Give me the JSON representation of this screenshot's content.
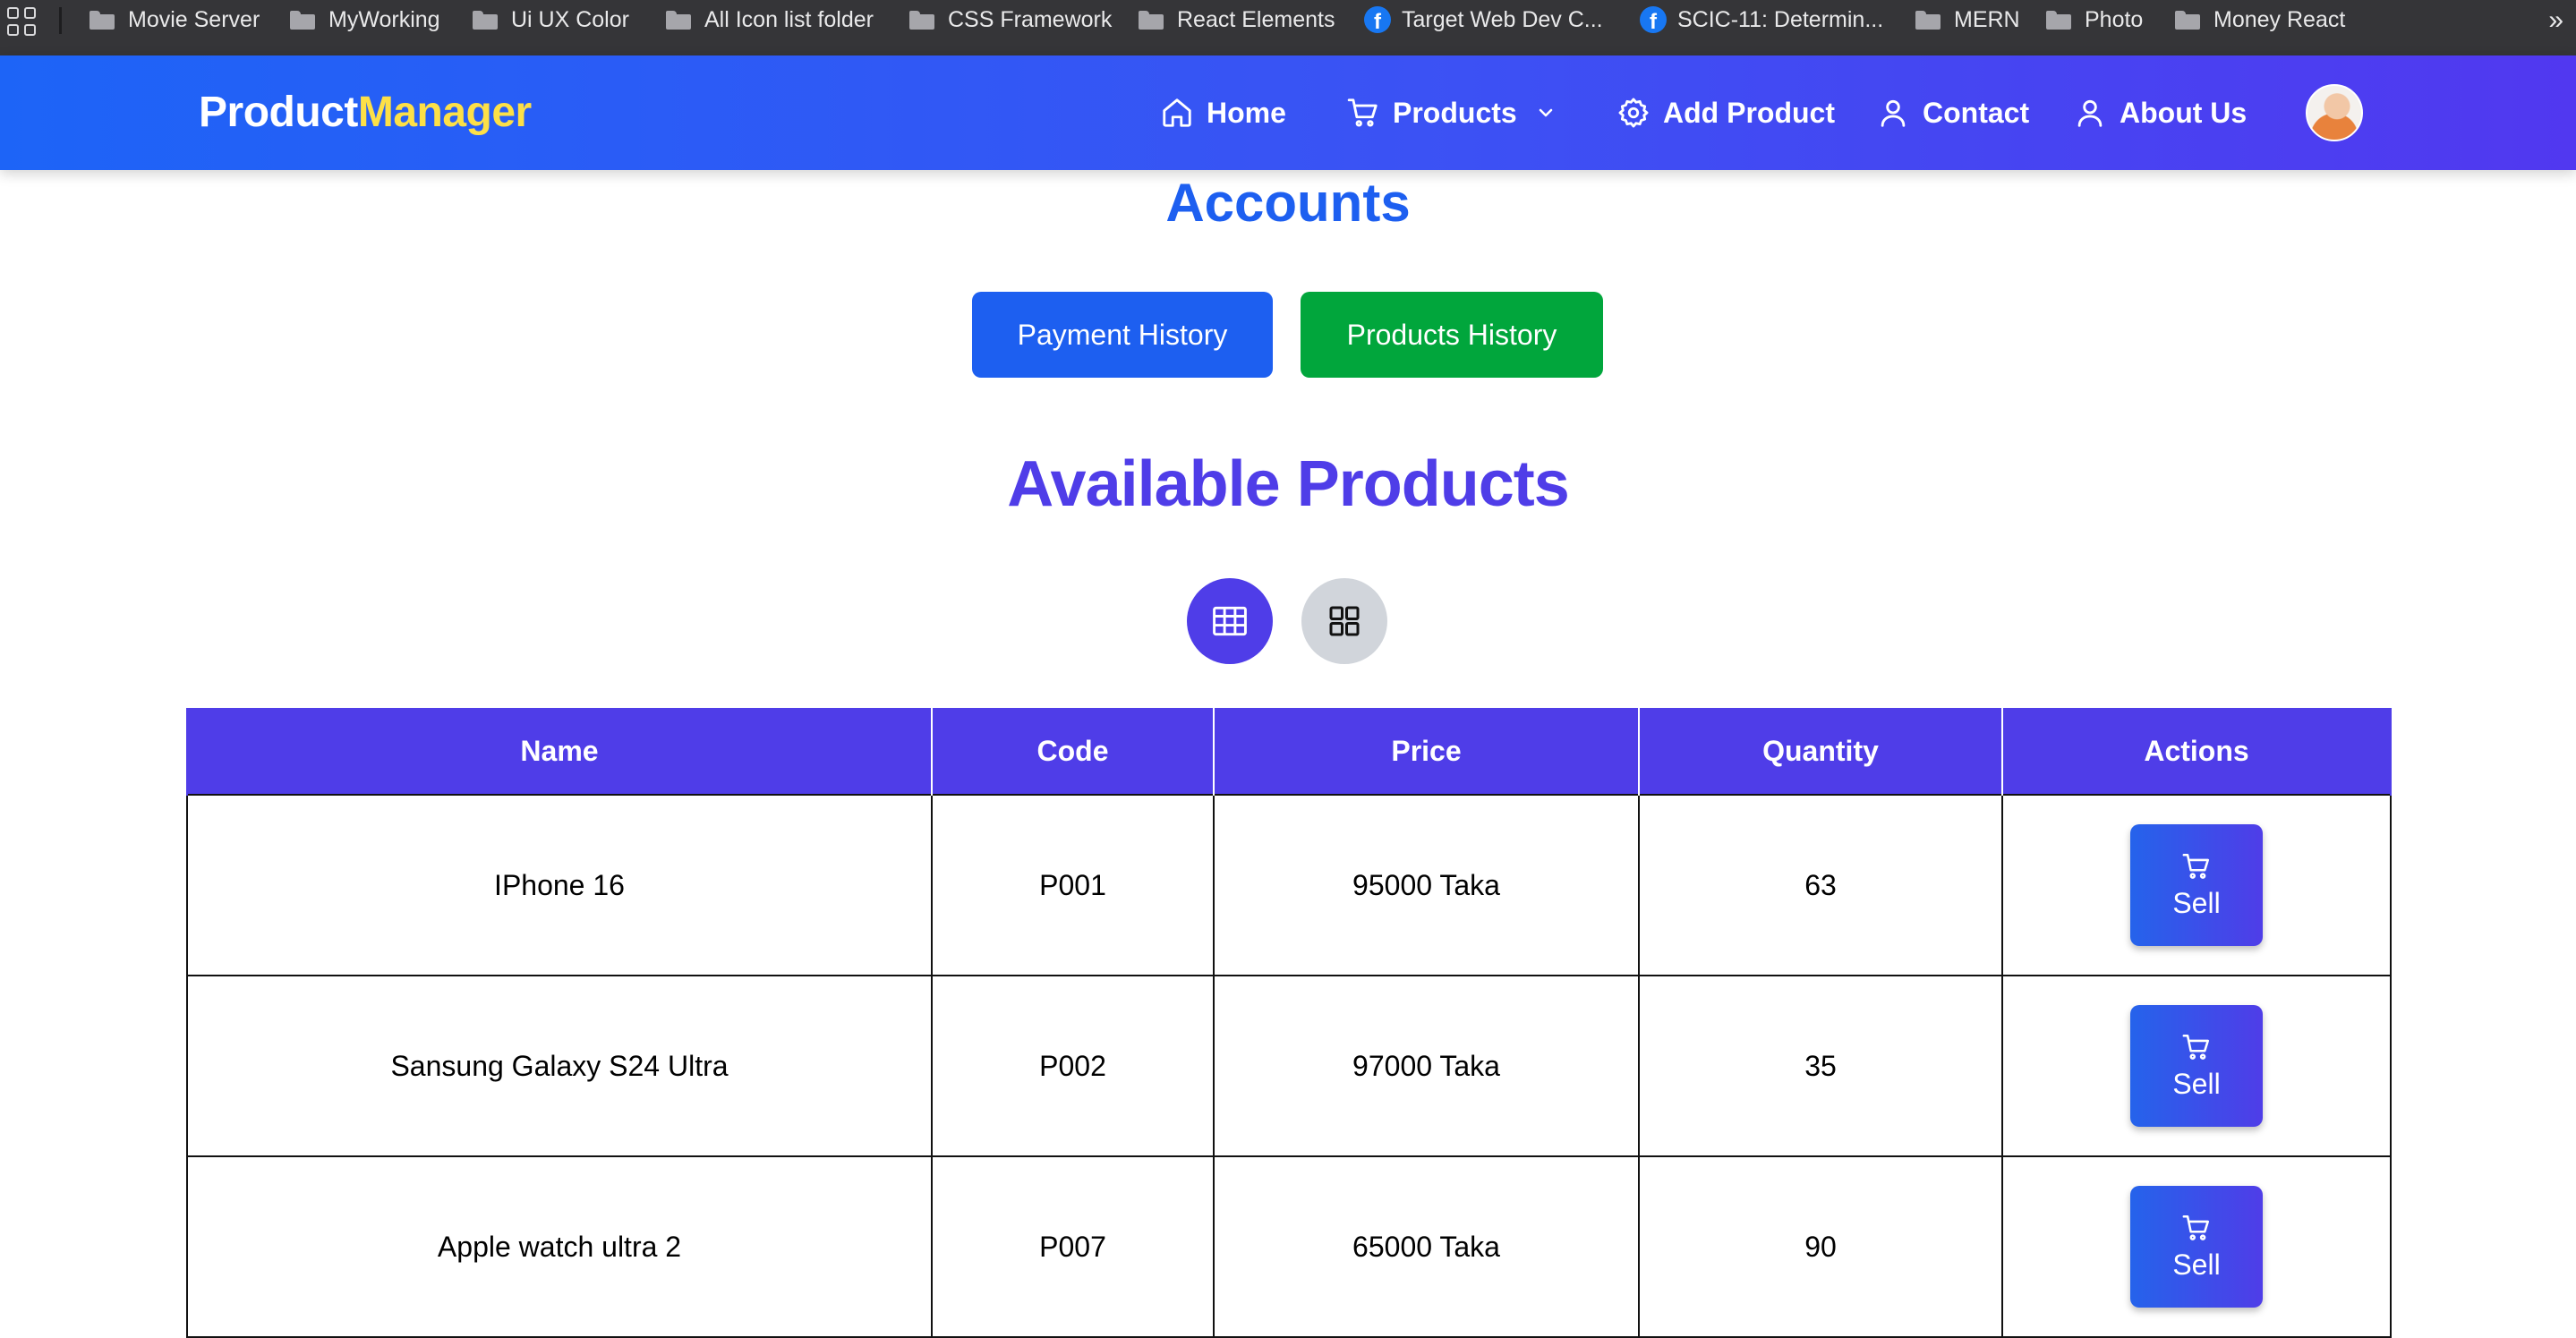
{
  "bookmarks": {
    "items": [
      {
        "label": "Movie Server",
        "icon": "folder-icon"
      },
      {
        "label": "MyWorking",
        "icon": "folder-icon"
      },
      {
        "label": "Ui UX Color",
        "icon": "folder-icon"
      },
      {
        "label": "All Icon list folder",
        "icon": "folder-icon"
      },
      {
        "label": "CSS Framework",
        "icon": "folder-icon"
      },
      {
        "label": "React Elements",
        "icon": "folder-icon"
      },
      {
        "label": "Target Web Dev C...",
        "icon": "facebook-icon"
      },
      {
        "label": "SCIC-11: Determin...",
        "icon": "facebook-icon"
      },
      {
        "label": "MERN",
        "icon": "folder-icon"
      },
      {
        "label": "Photo",
        "icon": "folder-icon"
      },
      {
        "label": "Money React",
        "icon": "folder-icon"
      }
    ],
    "more": "»"
  },
  "navbar": {
    "brand_part1": "Product",
    "brand_part2": "Manager",
    "links": {
      "home": "Home",
      "products": "Products",
      "add_product": "Add Product",
      "contact": "Contact",
      "about": "About Us"
    }
  },
  "accounts": {
    "title": "Accounts",
    "payment_history": "Payment History",
    "products_history": "Products History"
  },
  "products_section": {
    "title": "Available Products",
    "active_view": "table"
  },
  "table": {
    "headers": [
      "Name",
      "Code",
      "Price",
      "Quantity",
      "Actions"
    ],
    "rows": [
      {
        "name": "IPhone 16",
        "code": "P001",
        "price": "95000 Taka",
        "quantity": "63",
        "action": "Sell"
      },
      {
        "name": "Sansung Galaxy S24 Ultra",
        "code": "P002",
        "price": "97000 Taka",
        "quantity": "35",
        "action": "Sell"
      },
      {
        "name": "Apple watch ultra 2",
        "code": "P007",
        "price": "65000 Taka",
        "quantity": "90",
        "action": "Sell"
      }
    ]
  },
  "colors": {
    "navbar_start": "#1d64f7",
    "navbar_end": "#5138f0",
    "brand_accent": "#fde047",
    "accounts_title": "#1d5ff0",
    "products_title": "#4f3de8",
    "payment_button": "#1d5ff0",
    "products_history_button": "#01a63c",
    "table_header": "#4f3de8"
  }
}
